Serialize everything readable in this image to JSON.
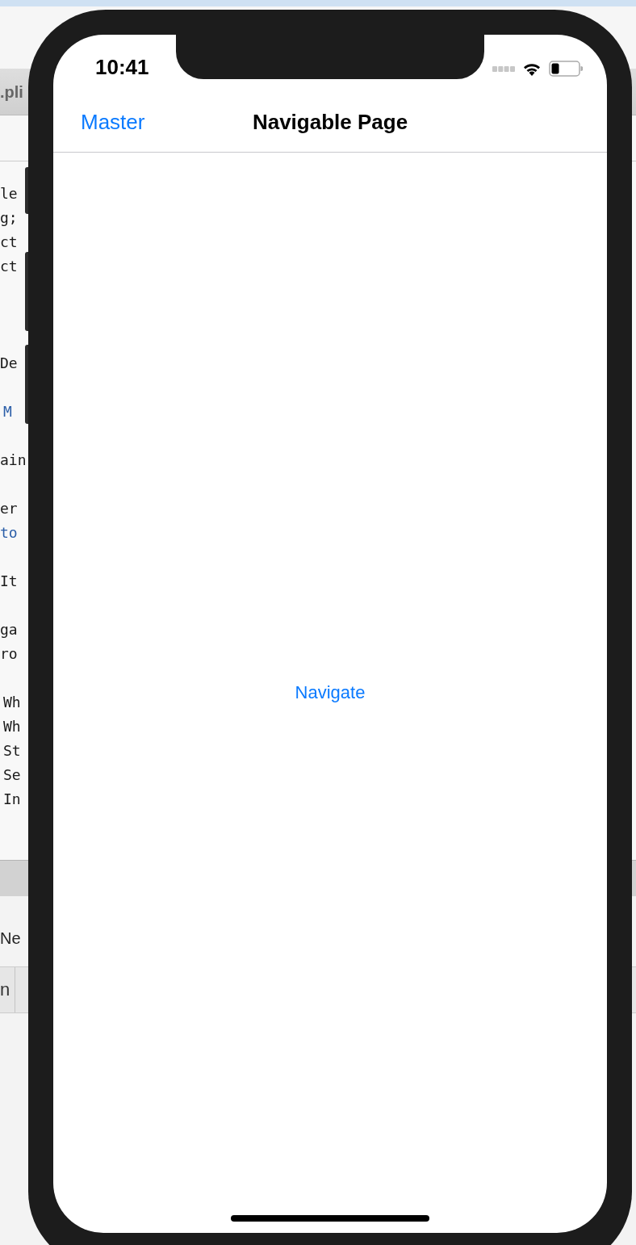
{
  "ide": {
    "tab": ".pli",
    "code_lines": [
      {
        "text": "le",
        "indented": false,
        "color": "#1a1a1a"
      },
      {
        "text": "g;",
        "indented": false,
        "color": "#1a1a1a"
      },
      {
        "text": "ct",
        "indented": false,
        "color": "#1a1a1a"
      },
      {
        "text": "ct",
        "indented": false,
        "color": "#1a1a1a"
      },
      {
        "text": "De",
        "indented": false,
        "color": "#1a1a1a"
      },
      {
        "text": "M",
        "indented": true,
        "color": "#2b5ea8"
      },
      {
        "text": "ain",
        "indented": false,
        "color": "#1a1a1a"
      },
      {
        "text": "er",
        "indented": false,
        "color": "#1a1a1a"
      },
      {
        "text": "to",
        "indented": false,
        "color": "#2b5ea8"
      },
      {
        "text": "It",
        "indented": false,
        "color": "#1a1a1a"
      },
      {
        "text": "ga",
        "indented": false,
        "color": "#1a1a1a"
      },
      {
        "text": "ro",
        "indented": false,
        "color": "#1a1a1a"
      },
      {
        "text": "Wh",
        "indented": true,
        "color": "#1a1a1a"
      },
      {
        "text": "Wh",
        "indented": true,
        "color": "#1a1a1a"
      },
      {
        "text": "St",
        "indented": true,
        "color": "#1a1a1a"
      },
      {
        "text": "Se",
        "indented": true,
        "color": "#1a1a1a"
      },
      {
        "text": "In",
        "indented": true,
        "color": "#1a1a1a"
      }
    ],
    "panel_label": "Ne",
    "columns": [
      "n"
    ]
  },
  "phone": {
    "status_bar": {
      "time": "10:41"
    },
    "nav_bar": {
      "back": "Master",
      "title": "Navigable Page"
    },
    "content": {
      "button": "Navigate"
    }
  }
}
